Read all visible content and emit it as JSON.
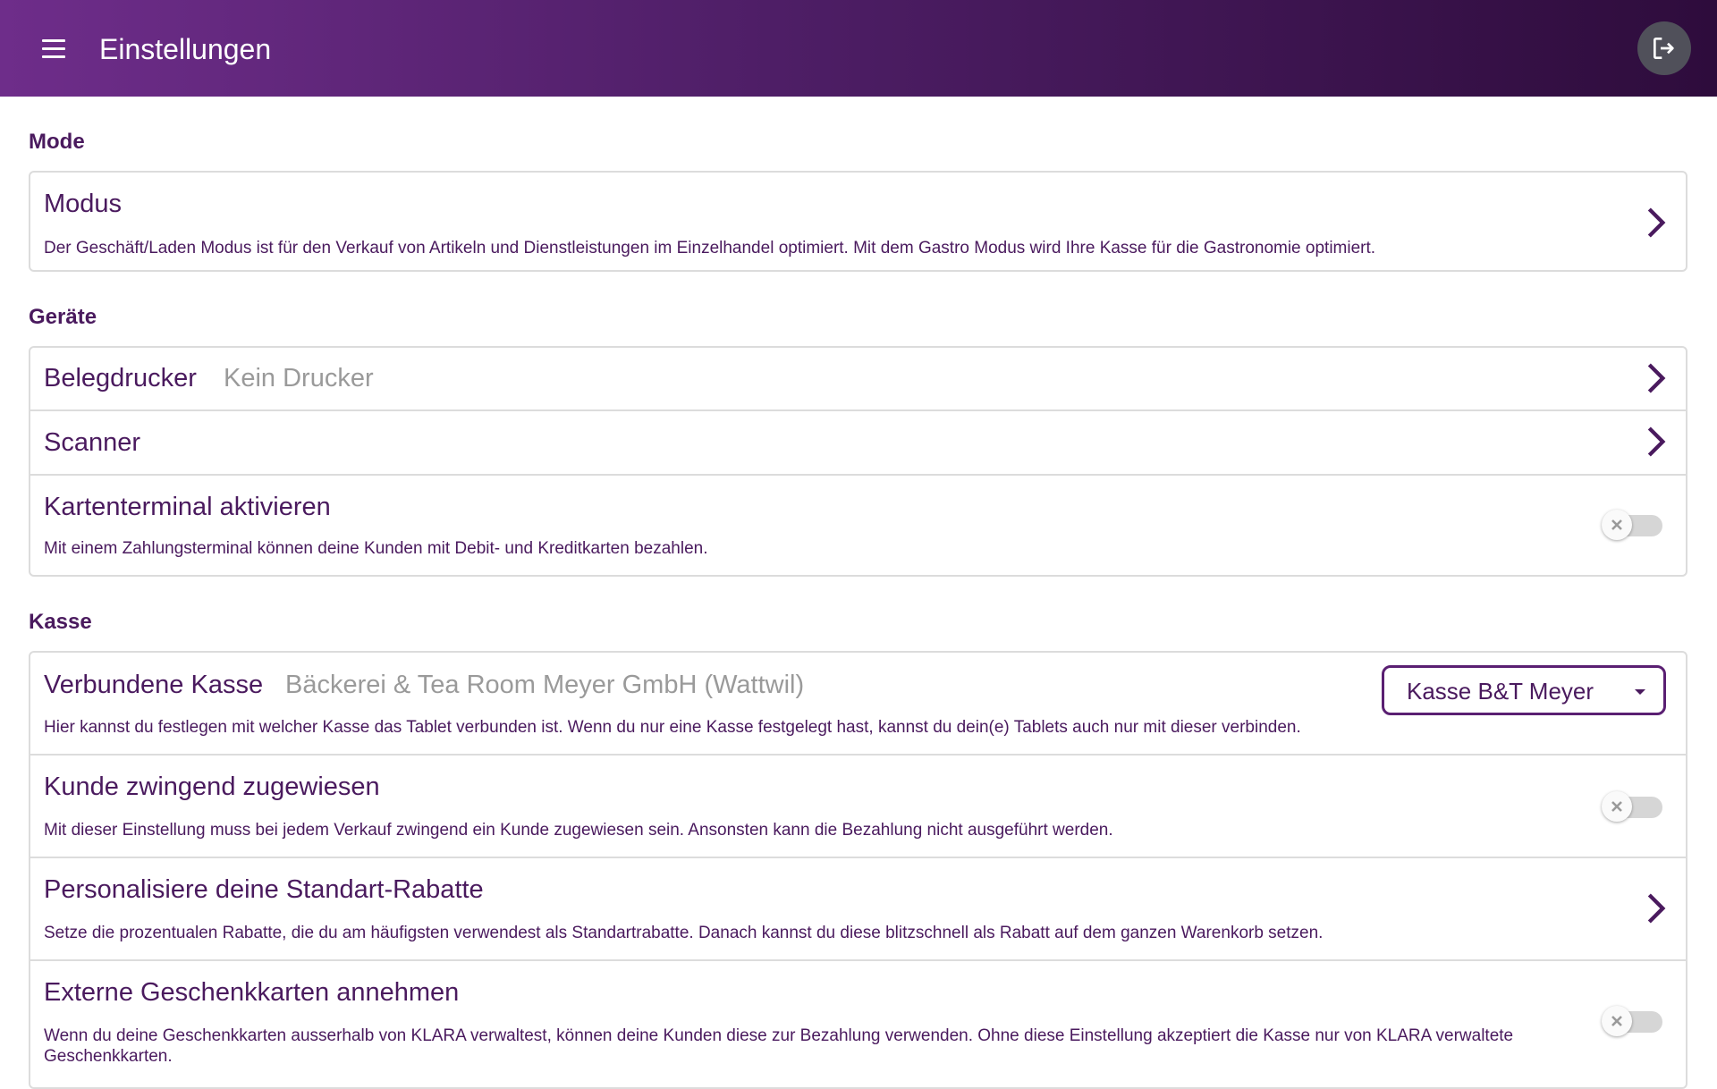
{
  "header": {
    "title": "Einstellungen",
    "menu_icon": "menu-icon",
    "logout_icon": "logout-icon"
  },
  "sections": {
    "mode": {
      "title": "Mode",
      "modus": {
        "title": "Modus",
        "description": "Der Geschäft/Laden Modus ist für den Verkauf von Artikeln und Dienstleistungen im Einzelhandel optimiert. Mit dem Gastro Modus wird Ihre Kasse für die Gastronomie optimiert."
      }
    },
    "geraete": {
      "title": "Geräte",
      "belegdrucker": {
        "title": "Belegdrucker",
        "value": "Kein Drucker"
      },
      "scanner": {
        "title": "Scanner"
      },
      "kartenterminal": {
        "title": "Kartenterminal aktivieren",
        "description": "Mit einem Zahlungsterminal können deine Kunden mit Debit- und Kreditkarten bezahlen.",
        "enabled": false
      }
    },
    "kasse": {
      "title": "Kasse",
      "verbundene_kasse": {
        "title": "Verbundene Kasse",
        "value": "Bäckerei & Tea Room Meyer GmbH (Wattwil)",
        "description": "Hier kannst du festlegen mit welcher Kasse das Tablet verbunden ist. Wenn du nur eine Kasse festgelegt hast, kannst du dein(e) Tablets auch nur mit dieser verbinden.",
        "selected": "Kasse B&T Meyer"
      },
      "kunde_zwingend": {
        "title": "Kunde zwingend zugewiesen",
        "description": "Mit dieser Einstellung muss bei jedem Verkauf zwingend ein Kunde zugewiesen sein. Ansonsten kann die Bezahlung nicht ausgeführt werden.",
        "enabled": false
      },
      "rabatte": {
        "title": "Personalisiere deine Standart-Rabatte",
        "description": "Setze die prozentualen Rabatte, die du am häufigsten verwendest als Standartrabatte. Danach kannst du diese blitzschnell als Rabatt auf dem ganzen Warenkorb setzen."
      },
      "geschenkkarten": {
        "title": "Externe Geschenkkarten annehmen",
        "description": "Wenn du deine Geschenkkarten ausserhalb von KLARA verwaltest, können deine Kunden diese zur Bezahlung verwenden. Ohne diese Einstellung akzeptiert die Kasse nur von KLARA verwaltete Geschenkkarten.",
        "enabled": false
      }
    }
  },
  "colors": {
    "accent": "#4a1a5e",
    "header_start": "#6e2d8a",
    "header_end": "#2e0c3c",
    "toggle_off": "#d6d6d6",
    "muted_text": "#9a9a9a"
  }
}
